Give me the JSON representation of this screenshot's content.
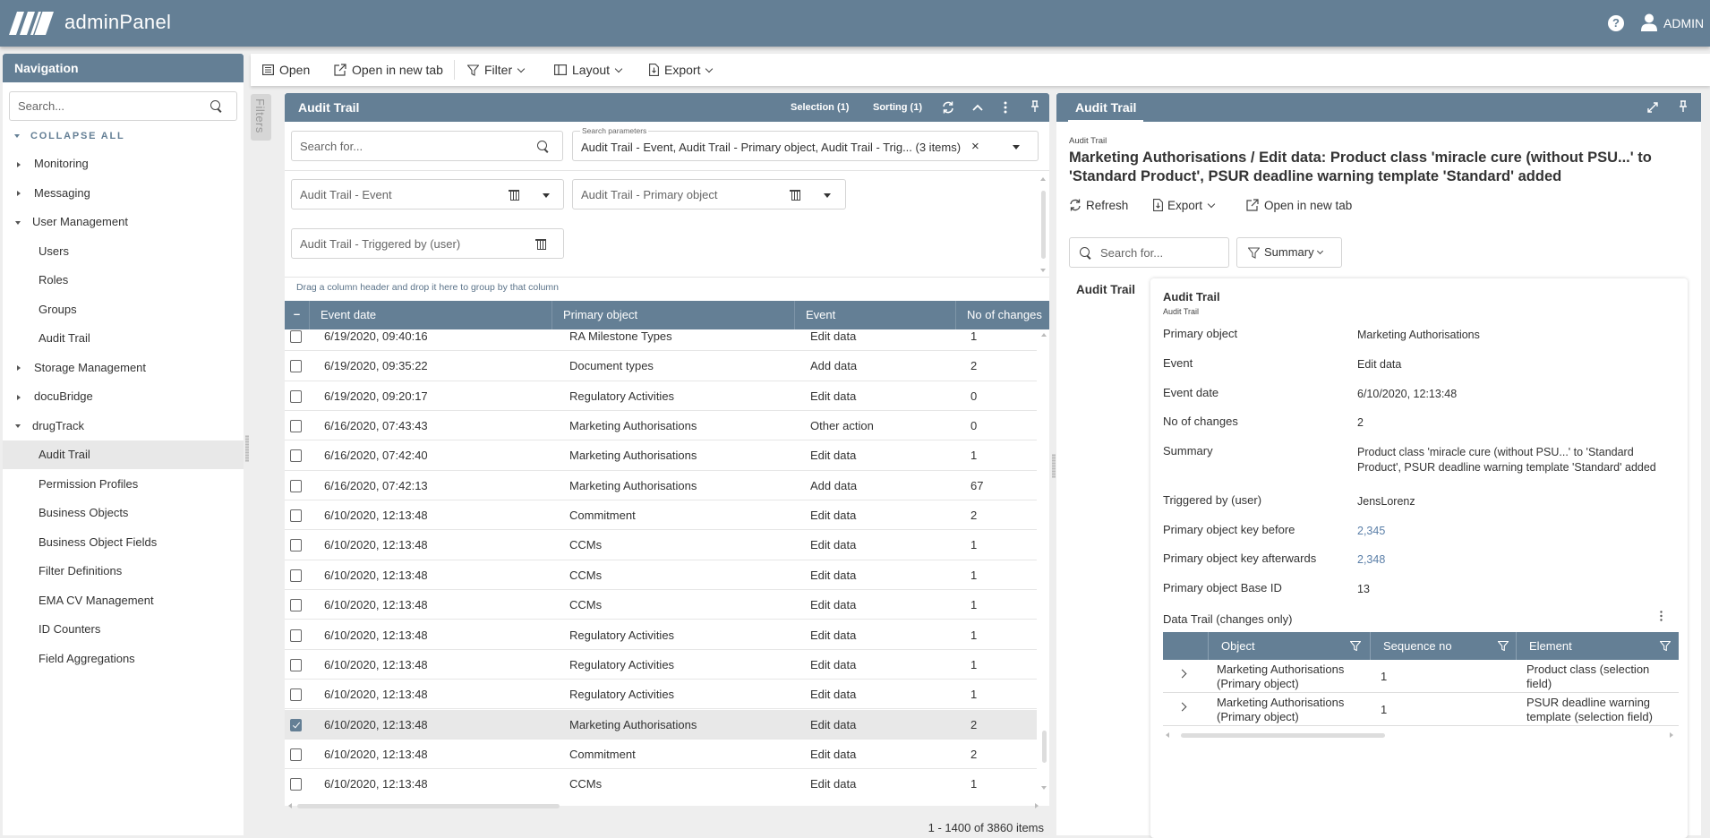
{
  "app": {
    "title": "adminPanel",
    "user": "ADMIN",
    "help_icon": "?",
    "logo_icon": "slashes-logo-icon"
  },
  "nav": {
    "header": "Navigation",
    "search_placeholder": "Search...",
    "collapse_all": "COLLAPSE ALL",
    "items": [
      {
        "label": "Monitoring",
        "level": 0,
        "state": "collapsed"
      },
      {
        "label": "Messaging",
        "level": 0,
        "state": "collapsed"
      },
      {
        "label": "User Management",
        "level": 0,
        "state": "expanded"
      },
      {
        "label": "Users",
        "level": 1
      },
      {
        "label": "Roles",
        "level": 1
      },
      {
        "label": "Groups",
        "level": 1
      },
      {
        "label": "Audit Trail",
        "level": 1
      },
      {
        "label": "Storage Management",
        "level": 0,
        "state": "collapsed"
      },
      {
        "label": "docuBridge",
        "level": 0,
        "state": "collapsed"
      },
      {
        "label": "drugTrack",
        "level": 0,
        "state": "expanded"
      },
      {
        "label": "Audit Trail",
        "level": 1,
        "active": true
      },
      {
        "label": "Permission Profiles",
        "level": 1
      },
      {
        "label": "Business Objects",
        "level": 1
      },
      {
        "label": "Business Object Fields",
        "level": 1
      },
      {
        "label": "Filter Definitions",
        "level": 1
      },
      {
        "label": "EMA CV Management",
        "level": 1
      },
      {
        "label": "ID Counters",
        "level": 1
      },
      {
        "label": "Field Aggregations",
        "level": 1
      }
    ]
  },
  "toolbar": {
    "open": "Open",
    "open_new_tab": "Open in new tab",
    "filter": "Filter",
    "layout": "Layout",
    "export": "Export"
  },
  "filters_tab": "Filters",
  "list": {
    "title": "Audit Trail",
    "selection": "Selection (1)",
    "sorting": "Sorting (1)",
    "search_placeholder": "Search for...",
    "search_params_label": "Search parameters",
    "search_params_value": "Audit Trail - Event, Audit Trail - Primary object, Audit Trail - Trig... (3 items)",
    "filter_chips": [
      "Audit Trail - Event",
      "Audit Trail - Primary object",
      "Audit Trail - Triggered by (user)"
    ],
    "group_hint": "Drag a column header and drop it here to group by that column",
    "columns": [
      "Event date",
      "Primary object",
      "Event",
      "No of changes"
    ],
    "rows": [
      {
        "date": "6/19/2020, 09:40:16",
        "object": "RA Milestone Types",
        "event": "Edit data",
        "changes": "1",
        "checked": false
      },
      {
        "date": "6/19/2020, 09:35:22",
        "object": "Document types",
        "event": "Add data",
        "changes": "2",
        "checked": false
      },
      {
        "date": "6/19/2020, 09:20:17",
        "object": "Regulatory Activities",
        "event": "Edit data",
        "changes": "0",
        "checked": false
      },
      {
        "date": "6/16/2020, 07:43:43",
        "object": "Marketing Authorisations",
        "event": "Other action",
        "changes": "0",
        "checked": false
      },
      {
        "date": "6/16/2020, 07:42:40",
        "object": "Marketing Authorisations",
        "event": "Edit data",
        "changes": "1",
        "checked": false
      },
      {
        "date": "6/16/2020, 07:42:13",
        "object": "Marketing Authorisations",
        "event": "Add data",
        "changes": "67",
        "checked": false
      },
      {
        "date": "6/10/2020, 12:13:48",
        "object": "Commitment",
        "event": "Edit data",
        "changes": "2",
        "checked": false
      },
      {
        "date": "6/10/2020, 12:13:48",
        "object": "CCMs",
        "event": "Edit data",
        "changes": "1",
        "checked": false
      },
      {
        "date": "6/10/2020, 12:13:48",
        "object": "CCMs",
        "event": "Edit data",
        "changes": "1",
        "checked": false
      },
      {
        "date": "6/10/2020, 12:13:48",
        "object": "CCMs",
        "event": "Edit data",
        "changes": "1",
        "checked": false
      },
      {
        "date": "6/10/2020, 12:13:48",
        "object": "Regulatory Activities",
        "event": "Edit data",
        "changes": "1",
        "checked": false
      },
      {
        "date": "6/10/2020, 12:13:48",
        "object": "Regulatory Activities",
        "event": "Edit data",
        "changes": "1",
        "checked": false
      },
      {
        "date": "6/10/2020, 12:13:48",
        "object": "Regulatory Activities",
        "event": "Edit data",
        "changes": "1",
        "checked": false
      },
      {
        "date": "6/10/2020, 12:13:48",
        "object": "Marketing Authorisations",
        "event": "Edit data",
        "changes": "2",
        "checked": true
      },
      {
        "date": "6/10/2020, 12:13:48",
        "object": "Commitment",
        "event": "Edit data",
        "changes": "2",
        "checked": false
      },
      {
        "date": "6/10/2020, 12:13:48",
        "object": "CCMs",
        "event": "Edit data",
        "changes": "1",
        "checked": false
      }
    ],
    "pager_info": "1 - 1400 of 3860 items"
  },
  "detail": {
    "tab": "Audit Trail",
    "breadcrumb": "Audit Trail",
    "title": "Marketing Authorisations / Edit data: Product class 'miracle cure (without PSU...' to 'Standard Product', PSUR deadline warning template 'Standard' added",
    "refresh": "Refresh",
    "export": "Export",
    "open_new_tab": "Open in new tab",
    "search_placeholder": "Search for...",
    "summary_btn": "Summary",
    "side_label": "Audit Trail",
    "card": {
      "title": "Audit Trail",
      "subtitle": "Audit Trail",
      "fields": [
        {
          "key": "Primary object",
          "value": "Marketing Authorisations",
          "link": false
        },
        {
          "key": "Event",
          "value": "Edit data",
          "link": false
        },
        {
          "key": "Event date",
          "value": "6/10/2020, 12:13:48",
          "link": false
        },
        {
          "key": "No of changes",
          "value": "2",
          "link": false
        },
        {
          "key": "Summary",
          "value": "Product class 'miracle cure (without PSU...' to 'Standard Product', PSUR deadline warning template 'Standard' added",
          "link": false
        },
        {
          "key": "Triggered by (user)",
          "value": "JensLorenz",
          "link": false
        },
        {
          "key": "Primary object key before",
          "value": "2,345",
          "link": true
        },
        {
          "key": "Primary object key afterwards",
          "value": "2,348",
          "link": true
        },
        {
          "key": "Primary object Base ID",
          "value": "13",
          "link": false
        }
      ],
      "data_trail": {
        "title": "Data Trail (changes only)",
        "columns": [
          "Object",
          "Sequence no",
          "Element"
        ],
        "rows": [
          {
            "object": "Marketing Authorisations (Primary object)",
            "seq": "1",
            "element": "Product class (selection field)"
          },
          {
            "object": "Marketing Authorisations (Primary object)",
            "seq": "1",
            "element": "PSUR deadline warning template (selection field)"
          }
        ]
      }
    }
  },
  "colors": {
    "brand": "#647f95",
    "selected_row": "#e8e8e8",
    "link": "#5b7fa8"
  }
}
